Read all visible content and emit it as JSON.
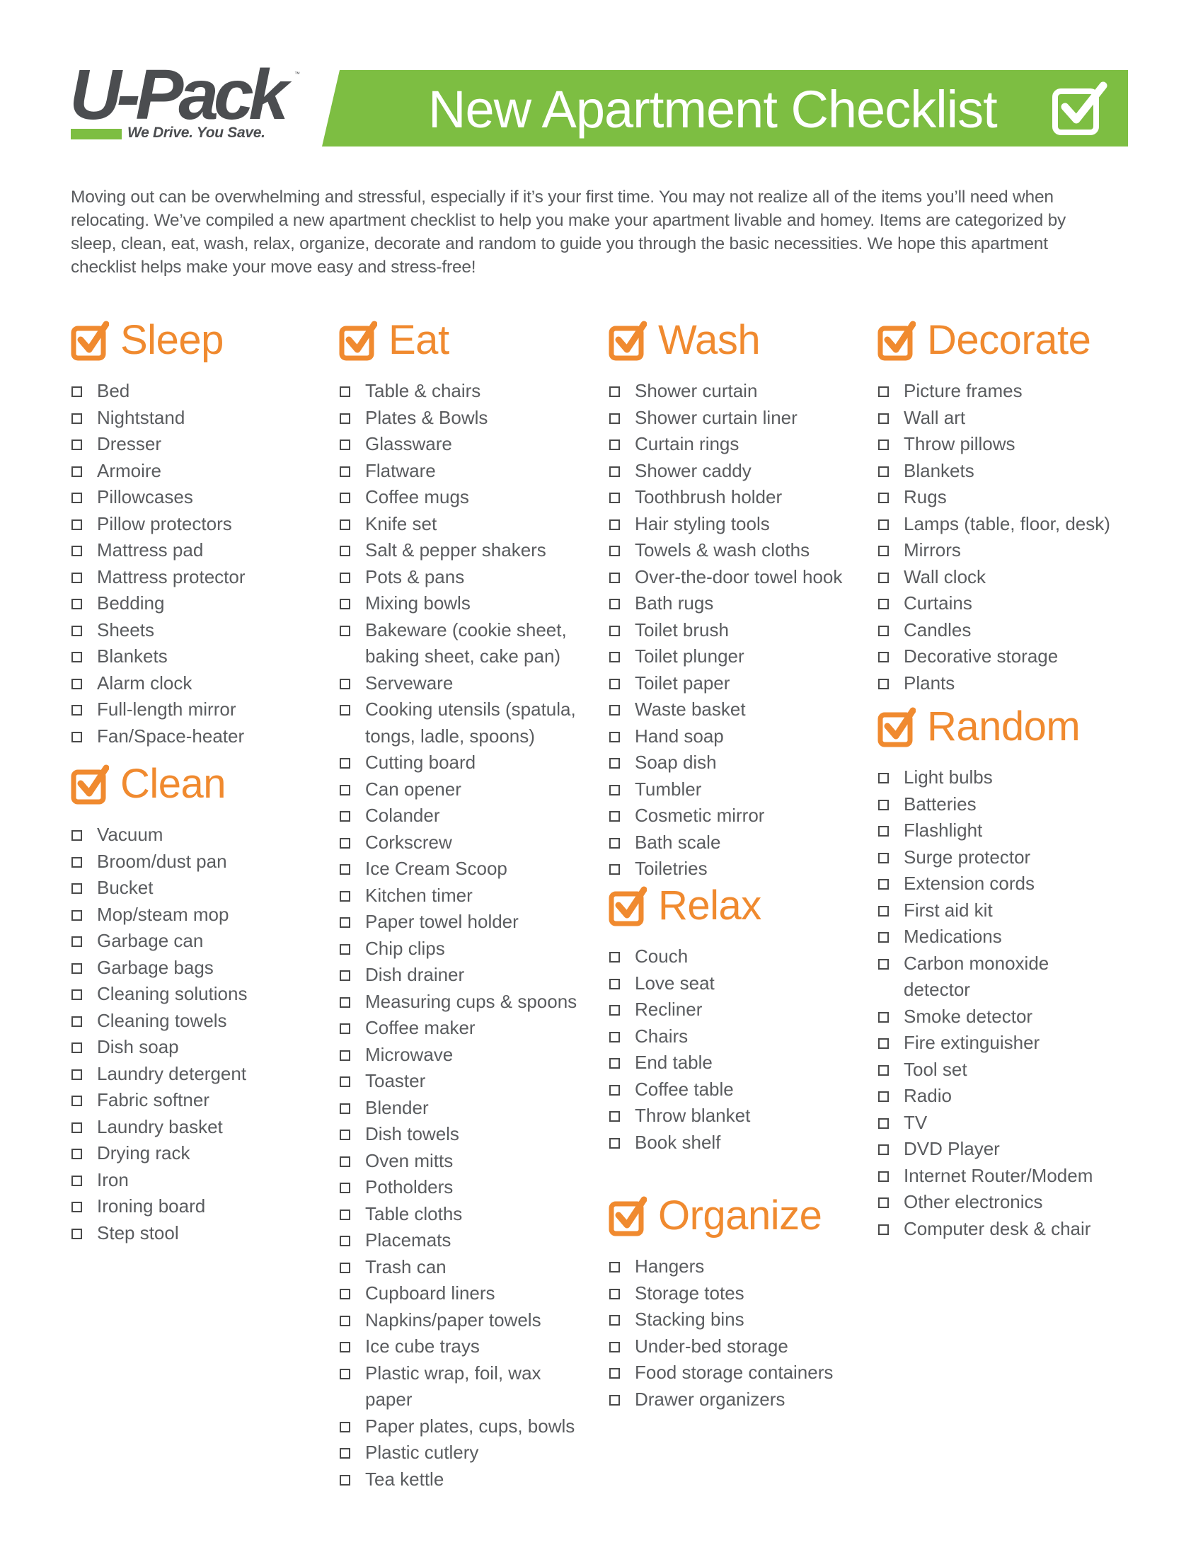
{
  "brand": {
    "logo_text": "U-Pack",
    "trademark": "™",
    "tagline": "We Drive. You Save.",
    "green": "#7dbe42",
    "dark": "#4b4d50",
    "accent_orange": "#f08a2f"
  },
  "header": {
    "title": "New Apartment Checklist",
    "icon": "checked-box-icon"
  },
  "intro": "Moving out can be overwhelming and stressful, especially if it’s your first time. You may not realize all of the items you’ll need when relocating. We’ve compiled a new apartment checklist to help you make your apartment livable and homey. Items are categorized by sleep, clean, eat, wash, relax, organize, decorate and random to guide you through the basic necessities. We hope this apartment checklist helps make your move easy and stress-free!",
  "sections": {
    "sleep": {
      "title": "Sleep",
      "items": [
        "Bed",
        "Nightstand",
        "Dresser",
        "Armoire",
        "Pillowcases",
        "Pillow protectors",
        "Mattress pad",
        "Mattress protector",
        "Bedding",
        "Sheets",
        "Blankets",
        "Alarm clock",
        "Full-length mirror",
        "Fan/Space-heater"
      ]
    },
    "clean": {
      "title": "Clean",
      "items": [
        "Vacuum",
        "Broom/dust pan",
        "Bucket",
        "Mop/steam mop",
        "Garbage can",
        "Garbage bags",
        "Cleaning solutions",
        "Cleaning towels",
        "Dish soap",
        "Laundry detergent",
        "Fabric softner",
        "Laundry basket",
        "Drying rack",
        "Iron",
        "Ironing board",
        "Step stool"
      ]
    },
    "eat": {
      "title": "Eat",
      "items": [
        "Table & chairs",
        "Plates & Bowls",
        "Glassware",
        "Flatware",
        "Coffee mugs",
        "Knife set",
        "Salt & pepper shakers",
        "Pots & pans",
        "Mixing bowls",
        "Bakeware (cookie sheet, baking sheet, cake pan)",
        "Serveware",
        "Cooking utensils (spatula, tongs, ladle, spoons)",
        "Cutting board",
        "Can opener",
        "Colander",
        "Corkscrew",
        "Ice Cream Scoop",
        "Kitchen timer",
        "Paper towel holder",
        "Chip clips",
        "Dish drainer",
        "Measuring cups & spoons",
        "Coffee maker",
        "Microwave",
        "Toaster",
        "Blender",
        "Dish towels",
        "Oven mitts",
        "Potholders",
        "Table cloths",
        "Placemats",
        "Trash can",
        "Cupboard liners",
        "Napkins/paper towels",
        "Ice cube trays",
        "Plastic wrap, foil, wax paper",
        "Paper plates, cups, bowls",
        "Plastic cutlery",
        "Tea kettle"
      ]
    },
    "wash": {
      "title": "Wash",
      "items": [
        "Shower curtain",
        "Shower curtain liner",
        "Curtain rings",
        "Shower caddy",
        "Toothbrush holder",
        "Hair styling tools",
        "Towels & wash cloths",
        "Over-the-door towel hook",
        "Bath rugs",
        "Toilet brush",
        "Toilet plunger",
        "Toilet paper",
        "Waste basket",
        "Hand soap",
        "Soap dish",
        "Tumbler",
        "Cosmetic mirror",
        "Bath scale",
        "Toiletries"
      ]
    },
    "relax": {
      "title": "Relax",
      "items": [
        "Couch",
        "Love seat",
        "Recliner",
        "Chairs",
        "End table",
        "Coffee table",
        "Throw blanket",
        "Book shelf"
      ]
    },
    "organize": {
      "title": "Organize",
      "items": [
        "Hangers",
        "Storage totes",
        "Stacking bins",
        "Under-bed storage",
        "Food storage containers",
        "Drawer organizers"
      ]
    },
    "decorate": {
      "title": "Decorate",
      "items": [
        "Picture frames",
        "Wall art",
        "Throw pillows",
        "Blankets",
        "Rugs",
        "Lamps (table, floor, desk)",
        "Mirrors",
        "Wall clock",
        "Curtains",
        "Candles",
        "Decorative storage",
        "Plants"
      ]
    },
    "random": {
      "title": "Random",
      "items": [
        "Light bulbs",
        "Batteries",
        "Flashlight",
        "Surge protector",
        "Extension cords",
        "First aid kit",
        "Medications",
        "Carbon monoxide detector",
        "Smoke detector",
        "Fire extinguisher",
        "Tool set",
        "Radio",
        "TV",
        "DVD Player",
        "Internet Router/Modem",
        "Other electronics",
        "Computer desk & chair"
      ]
    }
  }
}
